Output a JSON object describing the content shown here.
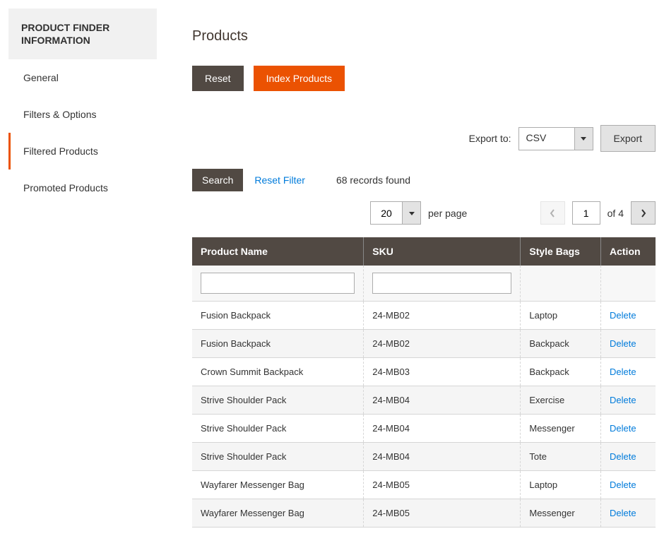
{
  "sidebar": {
    "header": "PRODUCT FINDER INFORMATION",
    "items": [
      {
        "label": "General",
        "active": false
      },
      {
        "label": "Filters & Options",
        "active": false
      },
      {
        "label": "Filtered Products",
        "active": true
      },
      {
        "label": "Promoted Products",
        "active": false
      }
    ]
  },
  "page_title": "Products",
  "buttons": {
    "reset": "Reset",
    "index": "Index Products",
    "export": "Export",
    "search": "Search",
    "reset_filter": "Reset Filter"
  },
  "export": {
    "label": "Export to:",
    "value": "CSV"
  },
  "records_found": "68 records found",
  "pager": {
    "page_size": "20",
    "per_page_label": "per page",
    "current_page": "1",
    "of_label": "of 4"
  },
  "table": {
    "headers": {
      "name": "Product Name",
      "sku": "SKU",
      "style": "Style Bags",
      "action": "Action"
    },
    "action_label": "Delete",
    "rows": [
      {
        "name": "Fusion Backpack",
        "sku": "24-MB02",
        "style": "Laptop"
      },
      {
        "name": "Fusion Backpack",
        "sku": "24-MB02",
        "style": "Backpack"
      },
      {
        "name": "Crown Summit Backpack",
        "sku": "24-MB03",
        "style": "Backpack"
      },
      {
        "name": "Strive Shoulder Pack",
        "sku": "24-MB04",
        "style": "Exercise"
      },
      {
        "name": "Strive Shoulder Pack",
        "sku": "24-MB04",
        "style": "Messenger"
      },
      {
        "name": "Strive Shoulder Pack",
        "sku": "24-MB04",
        "style": "Tote"
      },
      {
        "name": "Wayfarer Messenger Bag",
        "sku": "24-MB05",
        "style": "Laptop"
      },
      {
        "name": "Wayfarer Messenger Bag",
        "sku": "24-MB05",
        "style": "Messenger"
      }
    ]
  }
}
